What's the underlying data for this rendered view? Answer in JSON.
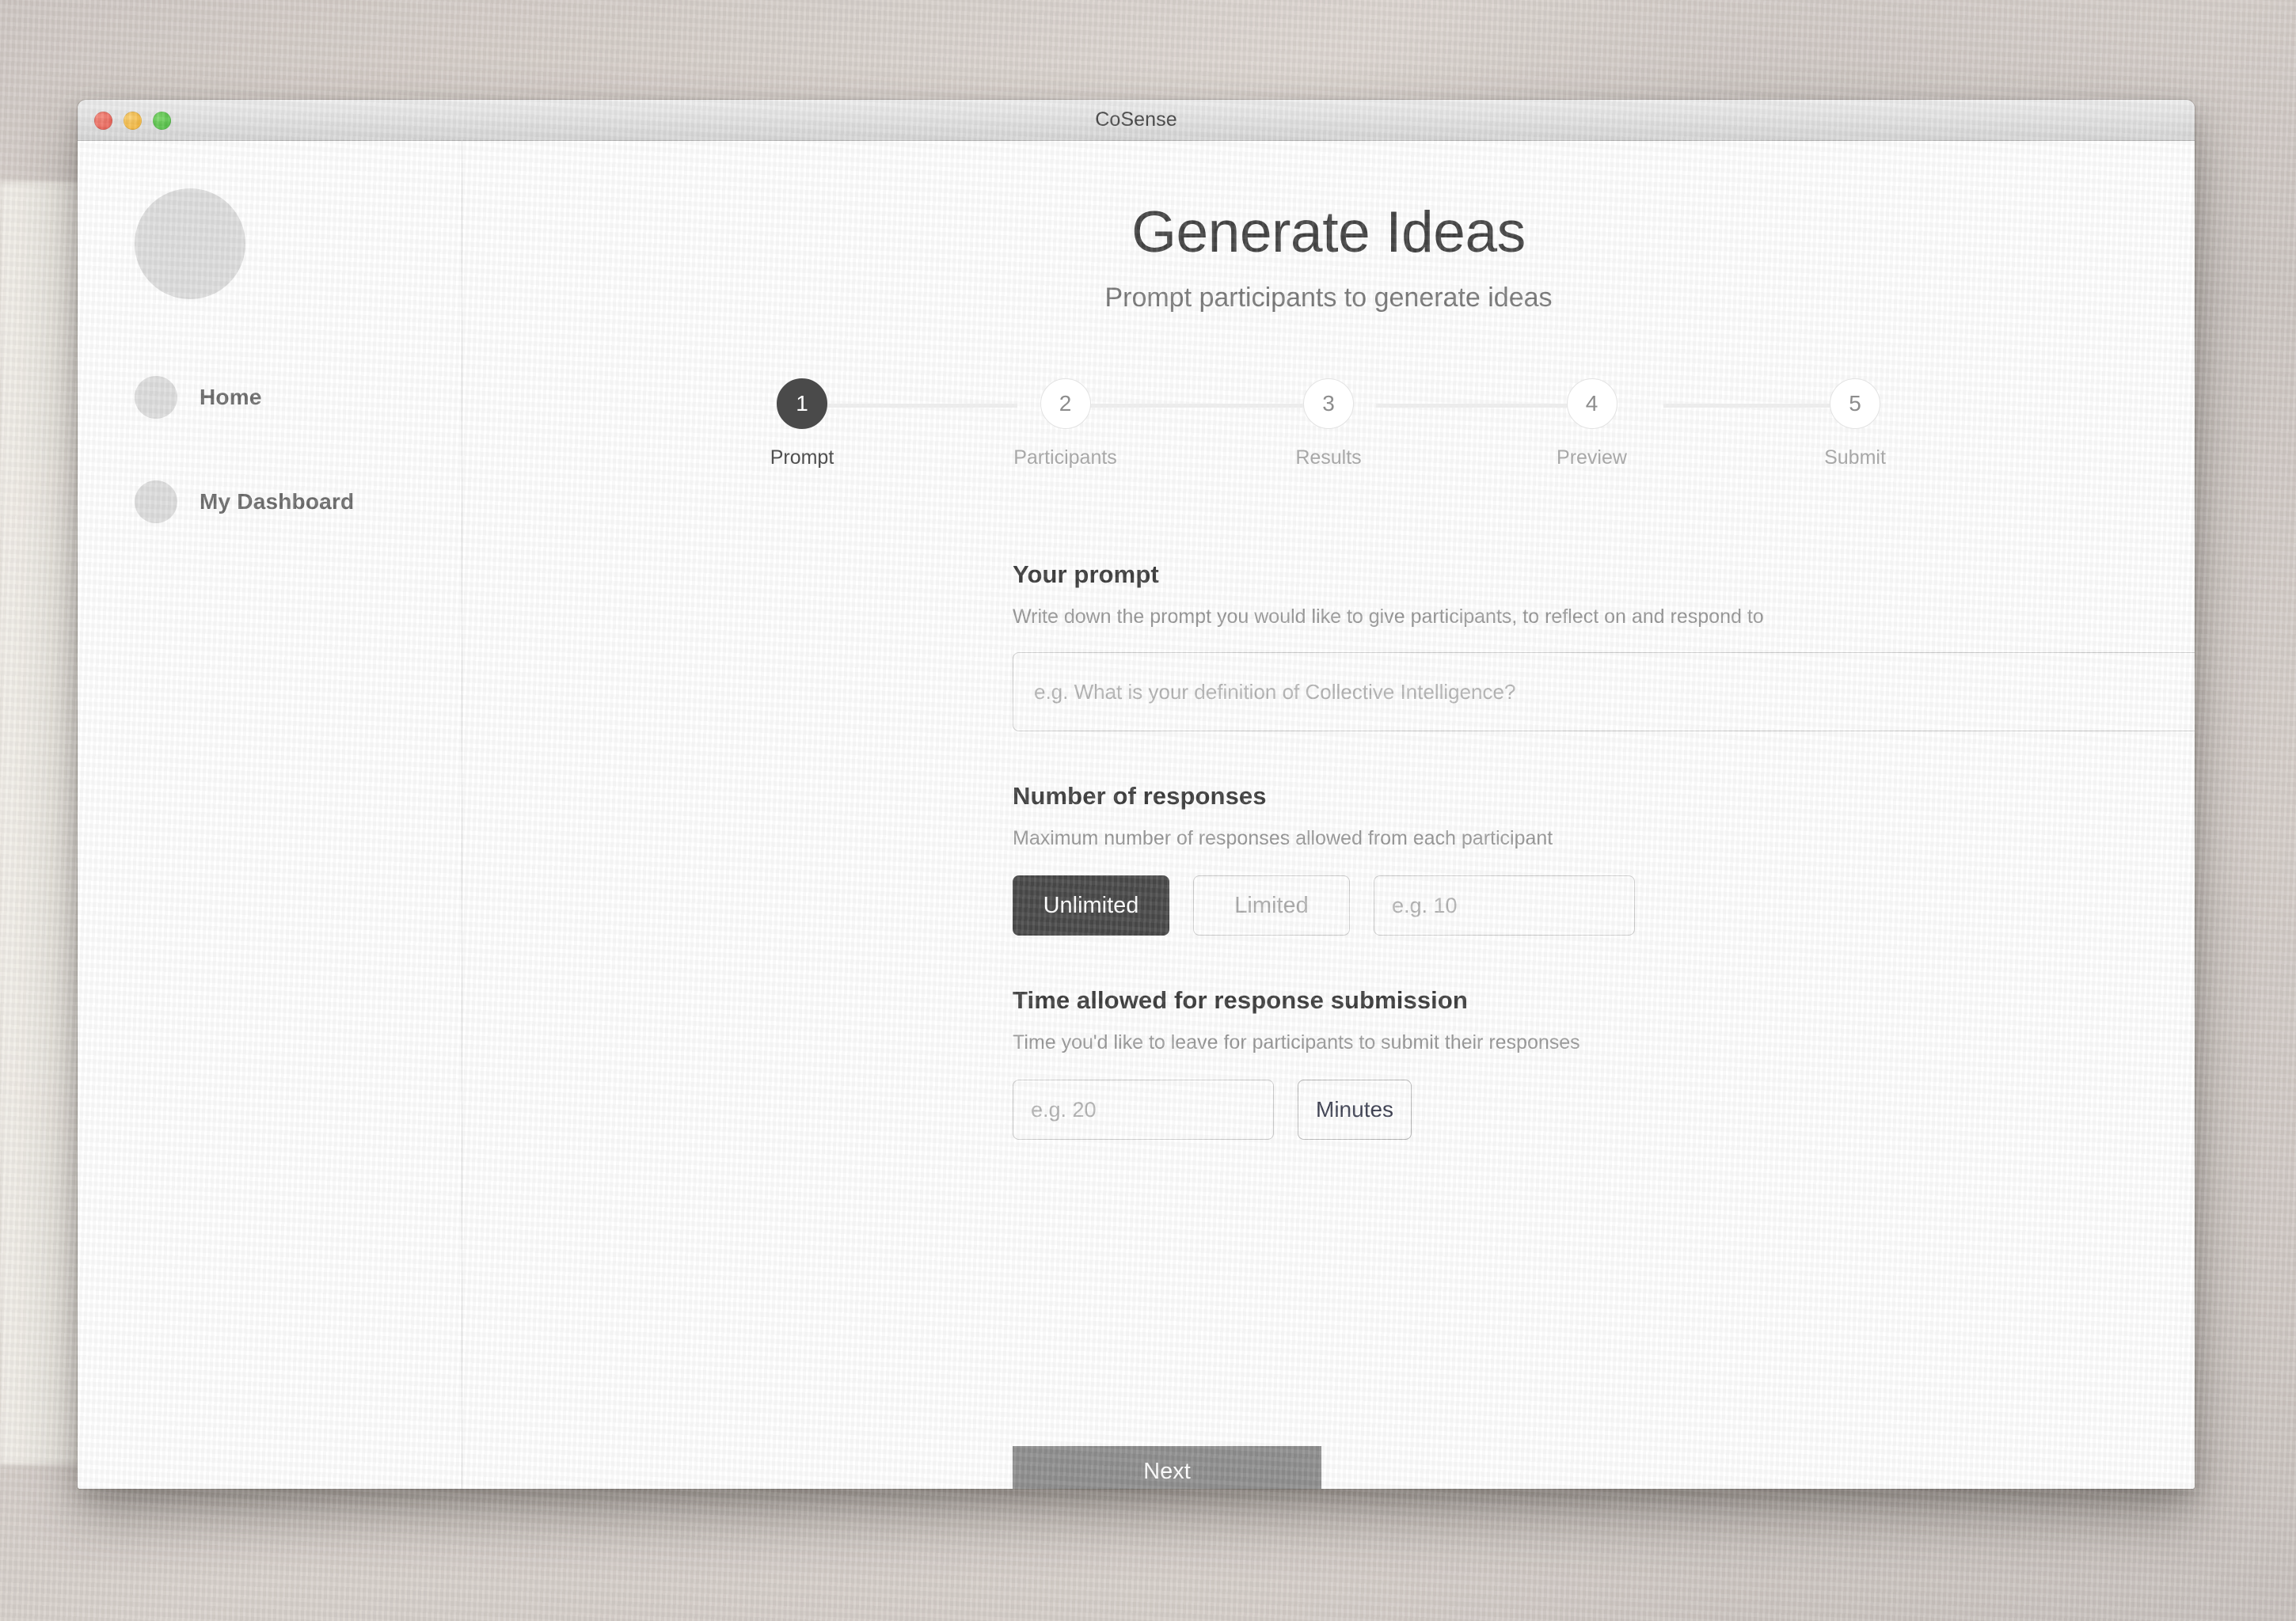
{
  "window": {
    "title": "CoSense",
    "traffic_lights": [
      {
        "name": "close",
        "color": "#ed6a5e"
      },
      {
        "name": "minimize",
        "color": "#f5bd4f"
      },
      {
        "name": "maximize",
        "color": "#61c554"
      }
    ]
  },
  "sidebar": {
    "avatar_icon": "avatar-placeholder-circle",
    "items": [
      {
        "label": "Home",
        "icon": "circle-icon"
      },
      {
        "label": "My Dashboard",
        "icon": "circle-icon"
      }
    ]
  },
  "page": {
    "title": "Generate Ideas",
    "subtitle": "Prompt participants to generate ideas"
  },
  "stepper": {
    "active_index": 0,
    "active_color": "#4a4a4a",
    "inactive_color": "#e3e3e3",
    "steps": [
      {
        "number": "1",
        "label": "Prompt"
      },
      {
        "number": "2",
        "label": "Participants"
      },
      {
        "number": "3",
        "label": "Results"
      },
      {
        "number": "4",
        "label": "Preview"
      },
      {
        "number": "5",
        "label": "Submit"
      }
    ]
  },
  "form": {
    "prompt": {
      "title": "Your prompt",
      "help": "Write down the prompt you would like to give participants, to reflect on and respond to",
      "value": "",
      "placeholder": "e.g. What is your definition of Collective Intelligence?"
    },
    "responses": {
      "title": "Number of responses",
      "help": "Maximum number of responses allowed from each participant",
      "options": [
        {
          "label": "Unlimited",
          "selected": true
        },
        {
          "label": "Limited",
          "selected": false
        }
      ],
      "count_value": "",
      "count_placeholder": "e.g. 10"
    },
    "time": {
      "title": "Time allowed for response submission",
      "help": "Time you'd like to leave for participants to submit their responses",
      "value": "",
      "placeholder": "e.g. 20",
      "unit_label": "Minutes"
    }
  },
  "footer": {
    "next_label": "Next",
    "next_color": "#8f8f8f"
  }
}
